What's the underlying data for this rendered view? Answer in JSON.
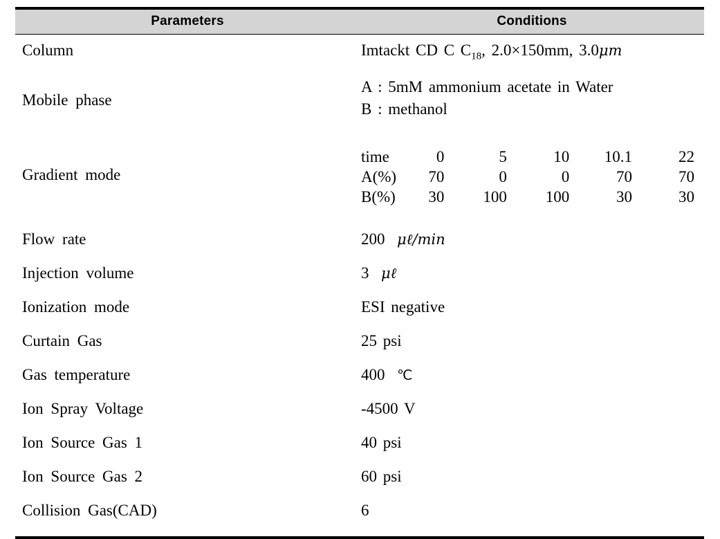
{
  "table": {
    "headers": {
      "parameters": "Parameters",
      "conditions": "Conditions"
    },
    "rows": [
      {
        "label": "Column",
        "value_prefix": "Imtackt  CD  C  C",
        "value_sub": "18",
        "value_suffix": ",  2.0×150mm,  3.0",
        "value_unit": "μm"
      },
      {
        "label": "Mobile  phase",
        "line_a": "A : 5mM  ammonium  acetate  in  Water",
        "line_b": "B : methanol"
      },
      {
        "label": "Gradient  mode",
        "grid": {
          "row_labels": [
            "time",
            "A(%)",
            "B(%)"
          ],
          "time": [
            "0",
            "5",
            "10",
            "10.1",
            "22"
          ],
          "a_percent": [
            "70",
            "0",
            "0",
            "70",
            "70"
          ],
          "b_percent": [
            "30",
            "100",
            "100",
            "30",
            "30"
          ]
        }
      },
      {
        "label": "Flow  rate",
        "value_num": "200",
        "value_unit": "μℓ/min"
      },
      {
        "label": "Injection  volume",
        "value_num": "3",
        "value_unit": "μℓ"
      },
      {
        "label": "Ionization  mode",
        "value": "ESI  negative"
      },
      {
        "label": "Curtain  Gas",
        "value": "25  psi"
      },
      {
        "label": "Gas  temperature",
        "value_num": "400",
        "value_unit": "℃"
      },
      {
        "label": "Ion  Spray  Voltage",
        "value": "-4500  V"
      },
      {
        "label": "Ion  Source  Gas 1",
        "value": "40  psi"
      },
      {
        "label": "Ion  Source  Gas 2",
        "value": "60  psi"
      },
      {
        "label": "Collision  Gas(CAD)",
        "value": "6"
      }
    ]
  },
  "style": {
    "header_background": "#d4d4d4",
    "rule_color": "#000000",
    "text_color": "#000000",
    "page_background": "#ffffff"
  }
}
